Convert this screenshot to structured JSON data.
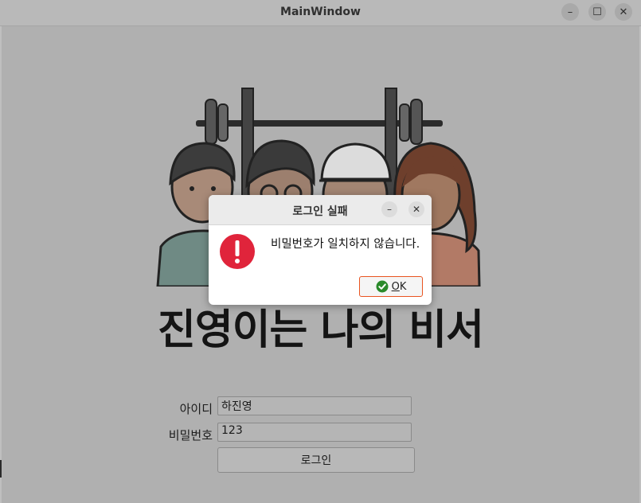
{
  "window": {
    "title": "MainWindow",
    "minimize_icon": "minimize-icon",
    "maximize_icon": "maximize-icon",
    "close_icon": "close-icon"
  },
  "main": {
    "illustration": "four-people-barbell-illustration",
    "headline": "진영이는 나의 비서",
    "id_label": "아이디",
    "id_value": "하진영",
    "password_label": "비밀번호",
    "password_value": "123",
    "login_button": "로그인"
  },
  "dialog": {
    "title": "로그인 실패",
    "message": "비밀번호가 일치하지 않습니다.",
    "icon": "error-icon",
    "ok_mnemonic": "O",
    "ok_rest": "K",
    "ok_icon": "check-circle-icon"
  },
  "colors": {
    "error_red": "#e0243b",
    "ok_green": "#2a8a2a",
    "focus_orange": "#e95420"
  }
}
